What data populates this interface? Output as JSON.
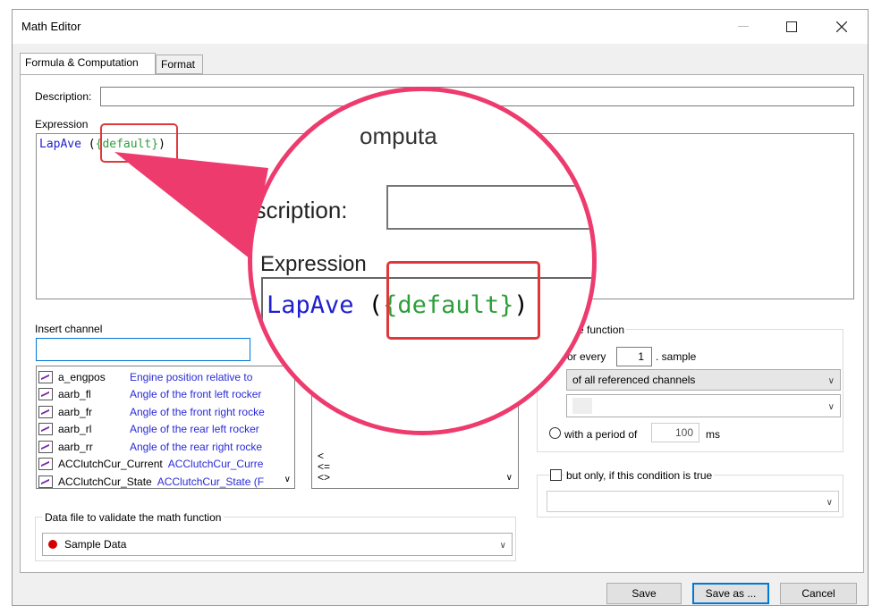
{
  "window": {
    "title": "Math Editor",
    "controls": [
      "minimize",
      "maximize",
      "close"
    ]
  },
  "tabs": [
    {
      "label": "Formula & Computation",
      "active": true
    },
    {
      "label": "Format",
      "active": false
    }
  ],
  "description": {
    "label": "Description:",
    "value": ""
  },
  "expression": {
    "label": "Expression",
    "func": "LapAve",
    "open": " (",
    "arg": "{default}",
    "close": ")"
  },
  "insert_channel": {
    "label": "Insert channel",
    "search_value": "",
    "channels": [
      {
        "name": "a_engpos",
        "desc": "Engine position relative to"
      },
      {
        "name": "aarb_fl",
        "desc": "Angle of the front left rocker"
      },
      {
        "name": "aarb_fr",
        "desc": "Angle of the front right rocke"
      },
      {
        "name": "aarb_rl",
        "desc": "Angle of the rear left rocker"
      },
      {
        "name": "aarb_rr",
        "desc": "Angle of the rear right rocke"
      },
      {
        "name": "ACClutchCur_Current",
        "desc": "ACClutchCur_Curre"
      },
      {
        "name": "ACClutchCur_State",
        "desc": "ACClutchCur_State (F"
      }
    ]
  },
  "operators": {
    "items": [
      "<",
      "<=",
      "<>"
    ]
  },
  "compute": {
    "group_label": "ute function",
    "for_every_label": "or every",
    "for_every_value": "1",
    "sample_label": ". sample",
    "scope_selected": "of all referenced channels",
    "channel_selected": "",
    "period_label": "with a period of",
    "period_value": "100",
    "period_unit": "ms",
    "condition_label": "but only, if this condition is true",
    "condition_value": ""
  },
  "data_file": {
    "group_label": "Data file to validate the math function",
    "selected": "Sample Data",
    "color": "#d40000"
  },
  "buttons": {
    "save": "Save",
    "save_as": "Save as ...",
    "cancel": "Cancel"
  },
  "zoom": {
    "heading_fragment": "omputa",
    "description_label": "escription:",
    "expression_label": "Expression",
    "func": "LapAve",
    "open": " (",
    "arg": "{default}",
    "close": ")"
  },
  "colors": {
    "accent": "#ee3b6e",
    "highlight": "#e0383a",
    "func_blue": "#2020d0",
    "arg_green": "#2e9e3a"
  }
}
